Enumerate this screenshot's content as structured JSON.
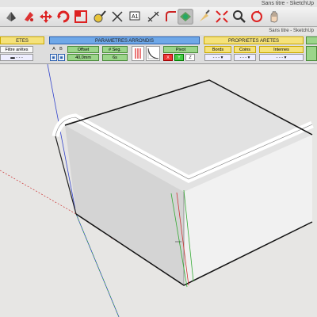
{
  "window": {
    "title": "Sans titre - SketchUp",
    "subtitle": "Sans titre - SketchUp"
  },
  "toolbar": {
    "tools": [
      "select-tool",
      "paint-tool",
      "move-tool",
      "rotate-tool",
      "scale-tool",
      "tape-tool",
      "axes-tool",
      "text-tool",
      "dimension-tool",
      "round-corner-tool",
      "sandbox-tool",
      "zoom-extents-tool",
      "zoom-window-tool",
      "orbit-tool",
      "pan-tool"
    ]
  },
  "panel": {
    "left_header": "ETES",
    "arrondis_header": "PARAMETRES ARRONDIS",
    "proprietes_header": "PROPRIETES ARETES",
    "filtre_label": "Filtre arêtes",
    "a_label": "A",
    "b_label": "B",
    "offset_label": "Offset",
    "offset_value": "40,0mm",
    "seg_label": "# Seg.",
    "seg_value": "6s",
    "pivot_label": "Pivot",
    "axis_x": "X",
    "axis_y": "Y",
    "axis_z": "Z",
    "bords_label": "Bords",
    "coins_label": "Coins",
    "internes_label": "Internes"
  },
  "colors": {
    "accent_blue": "#6fa8e8",
    "header_yellow": "#f5e27a",
    "green_field": "#9bd58a"
  }
}
